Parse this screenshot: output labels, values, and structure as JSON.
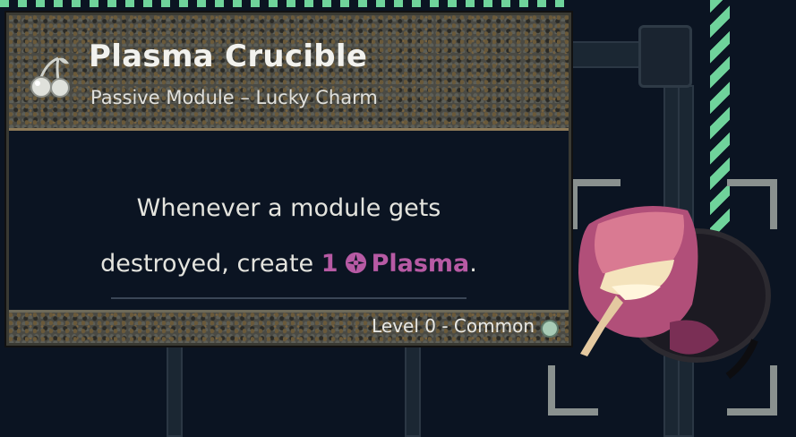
{
  "module": {
    "title": "Plasma Crucible",
    "subtitle": "Passive Module – Lucky Charm",
    "icon": "cherry-icon",
    "description": {
      "line1": "Whenever a module gets",
      "line2_prefix": "destroyed, create",
      "amount": "1",
      "resource_icon": "plasma-icon",
      "resource_name": "Plasma",
      "suffix": "."
    },
    "rarity": "Level 0 - Common",
    "rarity_color": "#a8cbb5",
    "keyword_color": "#b75aa4"
  }
}
